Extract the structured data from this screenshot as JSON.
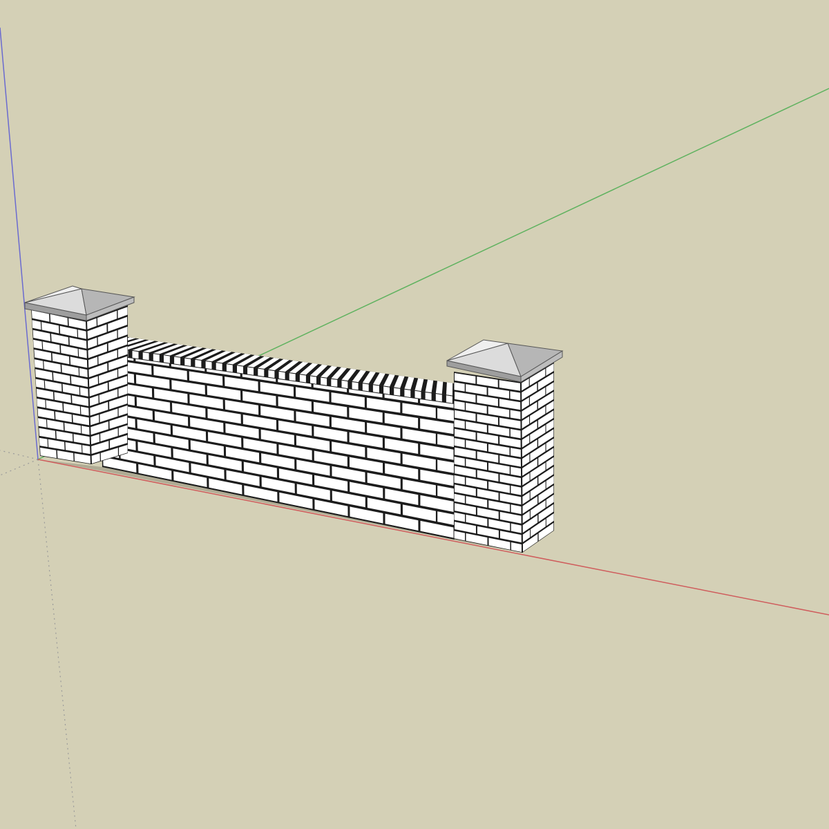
{
  "viewport": {
    "background_color": "#d4d0b6"
  },
  "axes": {
    "red_color": "#cf5c5c",
    "green_color": "#5fb25f",
    "blue_color": "#6a6ad0",
    "hidden_color": "#9a9a9a"
  },
  "model": {
    "brick_face_color": "#ffffff",
    "mortar_color": "#1c1c1c",
    "cap_light_color": "#e2e2e2",
    "cap_dark_color": "#9e9e9e",
    "shadow_color": "#8f8c79"
  }
}
